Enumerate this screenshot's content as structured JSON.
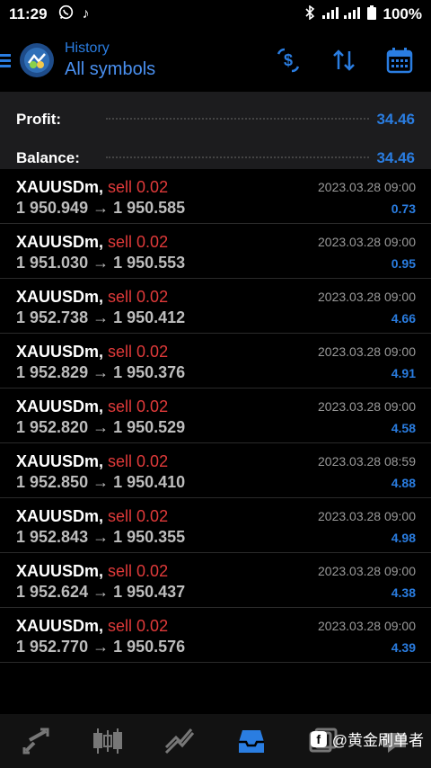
{
  "status_bar": {
    "time": "11:29",
    "battery": "100%"
  },
  "header": {
    "subtitle": "History",
    "title": "All symbols"
  },
  "summary": {
    "profit_label": "Profit:",
    "profit_value": "34.46",
    "balance_label": "Balance:",
    "balance_value": "34.46"
  },
  "trades": [
    {
      "symbol": "XAUUSDm,",
      "side": "sell 0.02",
      "prices": "1 950.949 → 1 950.585",
      "date": "2023.03.28 09:00",
      "profit": "0.73"
    },
    {
      "symbol": "XAUUSDm,",
      "side": "sell 0.02",
      "prices": "1 951.030 → 1 950.553",
      "date": "2023.03.28 09:00",
      "profit": "0.95"
    },
    {
      "symbol": "XAUUSDm,",
      "side": "sell 0.02",
      "prices": "1 952.738 → 1 950.412",
      "date": "2023.03.28 09:00",
      "profit": "4.66"
    },
    {
      "symbol": "XAUUSDm,",
      "side": "sell 0.02",
      "prices": "1 952.829 → 1 950.376",
      "date": "2023.03.28 09:00",
      "profit": "4.91"
    },
    {
      "symbol": "XAUUSDm,",
      "side": "sell 0.02",
      "prices": "1 952.820 → 1 950.529",
      "date": "2023.03.28 09:00",
      "profit": "4.58"
    },
    {
      "symbol": "XAUUSDm,",
      "side": "sell 0.02",
      "prices": "1 952.850 → 1 950.410",
      "date": "2023.03.28 08:59",
      "profit": "4.88"
    },
    {
      "symbol": "XAUUSDm,",
      "side": "sell 0.02",
      "prices": "1 952.843 → 1 950.355",
      "date": "2023.03.28 09:00",
      "profit": "4.98"
    },
    {
      "symbol": "XAUUSDm,",
      "side": "sell 0.02",
      "prices": "1 952.624 → 1 950.437",
      "date": "2023.03.28 09:00",
      "profit": "4.38"
    },
    {
      "symbol": "XAUUSDm,",
      "side": "sell 0.02",
      "prices": "1 952.770 → 1 950.576",
      "date": "2023.03.28 09:00",
      "profit": "4.39"
    }
  ],
  "watermark": {
    "text": "@黄金刷单者"
  },
  "colors": {
    "accent": "#2a7de1",
    "sell": "#e03a3a",
    "background": "#000000",
    "summary_bg": "#1c1c1e"
  },
  "icons": [
    "whatsapp-icon",
    "music-note-icon",
    "bluetooth-icon",
    "signal-icon",
    "battery-icon",
    "hamburger-icon",
    "app-logo-icon",
    "exchange-dollar-icon",
    "sort-icon",
    "calendar-icon",
    "quotes-nav-icon",
    "chart-nav-icon",
    "trade-nav-icon",
    "history-nav-icon",
    "messages-nav-icon"
  ]
}
